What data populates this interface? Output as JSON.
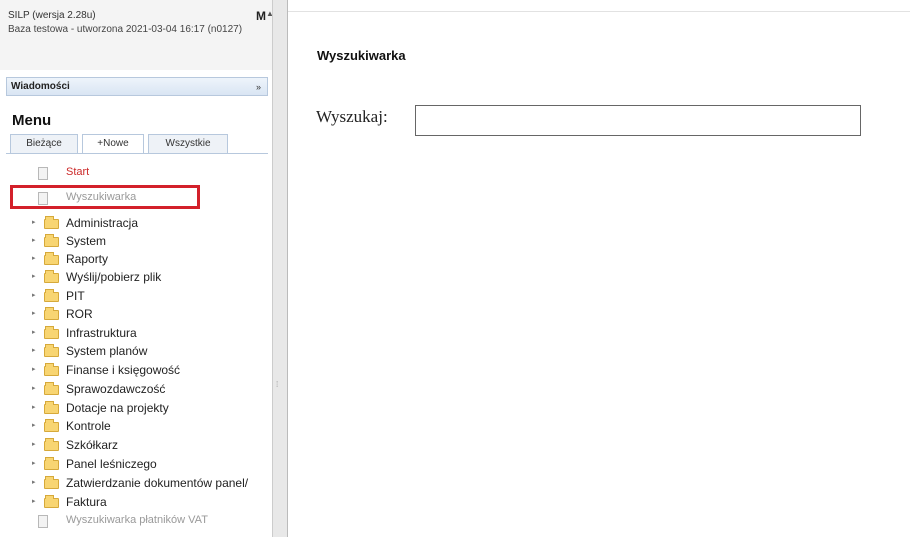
{
  "header": {
    "app_version": "SILP (wersja 2.28u)",
    "db_info": "Baza testowa - utworzona 2021-03-04 16:17 (n0127)",
    "m_label": "M",
    "collapse_icon": "up-arrow-icon"
  },
  "messages": {
    "label": "Wiadomości",
    "arrow": "»"
  },
  "menu": {
    "title": "Menu",
    "tabs": [
      "Bieżące",
      "+Nowe",
      "Wszystkie"
    ],
    "items": [
      {
        "label": "Start",
        "type": "doc",
        "color": "#cc2a2a"
      },
      {
        "label": "Wyszukiwarka",
        "type": "doc",
        "color": "#9a9a9a"
      },
      {
        "label": "Administracja",
        "type": "folder"
      },
      {
        "label": "System",
        "type": "folder"
      },
      {
        "label": "Raporty",
        "type": "folder"
      },
      {
        "label": "Wyślij/pobierz plik",
        "type": "folder"
      },
      {
        "label": "PIT",
        "type": "folder"
      },
      {
        "label": "ROR",
        "type": "folder"
      },
      {
        "label": "Infrastruktura",
        "type": "folder"
      },
      {
        "label": "System planów",
        "type": "folder"
      },
      {
        "label": "Finanse i księgowość",
        "type": "folder"
      },
      {
        "label": "Sprawozdawczość",
        "type": "folder"
      },
      {
        "label": "Dotacje na projekty",
        "type": "folder"
      },
      {
        "label": "Kontrole",
        "type": "folder"
      },
      {
        "label": "Szkółkarz",
        "type": "folder"
      },
      {
        "label": "Panel leśniczego",
        "type": "folder"
      },
      {
        "label": "Zatwierdzanie dokumentów panel/",
        "type": "folder"
      },
      {
        "label": "Faktura",
        "type": "folder"
      },
      {
        "label": "Wyszukiwarka płatników VAT",
        "type": "doc",
        "color": "#9a9a9a"
      }
    ]
  },
  "main": {
    "title": "Wyszukiwarka",
    "search_label": "Wyszukaj:",
    "search_value": ""
  }
}
